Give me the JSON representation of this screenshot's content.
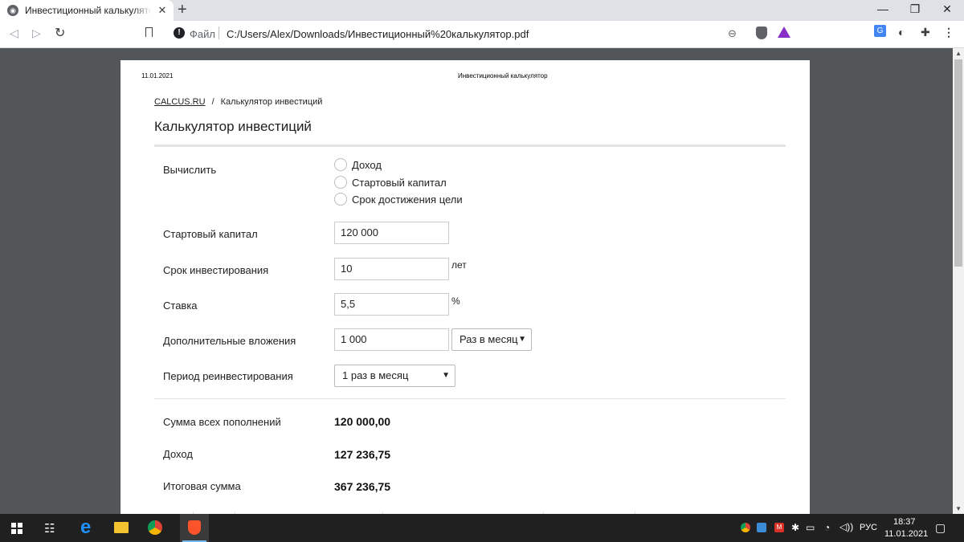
{
  "browser": {
    "tab_title": "Инвестиционный калькулятор.pdf",
    "tab_close": "✕",
    "new_tab": "+",
    "omnibox_scheme_label": "Файл",
    "omnibox_url": "C:/Users/Alex/Downloads/Инвестиционный%20калькулятор.pdf",
    "window_controls": {
      "minimize": "—",
      "restore": "❐",
      "close": "✕"
    },
    "nav": {
      "back": "◁",
      "forward": "▷",
      "reload": "↻"
    },
    "icons": [
      "bookmark-icon",
      "info-icon",
      "zoom-icon",
      "brave-shields-icon",
      "brave-rewards-icon",
      "translate-icon",
      "extensions-icon",
      "menu-icon"
    ]
  },
  "pdf": {
    "print_date": "11.01.2021",
    "print_header": "Инвестиционный калькулятор",
    "breadcrumb": {
      "home": "CALCUS.RU",
      "separator": "/",
      "current": "Калькулятор инвестиций"
    },
    "title": "Калькулятор инвестиций",
    "form": {
      "compute_label": "Вычислить",
      "compute_options": [
        "Доход",
        "Стартовый капитал",
        "Срок достижения цели"
      ],
      "start_capital_label": "Стартовый капитал",
      "start_capital_value": "120 000",
      "term_label": "Срок инвестирования",
      "term_value": "10",
      "term_unit": "лет",
      "rate_label": "Ставка",
      "rate_value": "5,5",
      "rate_unit": "%",
      "extra_label": "Дополнительные вложения",
      "extra_value": "1 000",
      "extra_period": "Раз в месяц",
      "reinvest_label": "Период реинвестирования",
      "reinvest_value": "1 раз в месяц"
    },
    "results": {
      "total_topups_label": "Сумма всех пополнений",
      "total_topups_value": "120 000,00",
      "income_label": "Доход",
      "income_value": "127 236,75",
      "final_label": "Итоговая сумма",
      "final_value": "367 236,75"
    }
  },
  "taskbar": {
    "language": "РУС",
    "time": "18:37",
    "date": "11.01.2021"
  }
}
